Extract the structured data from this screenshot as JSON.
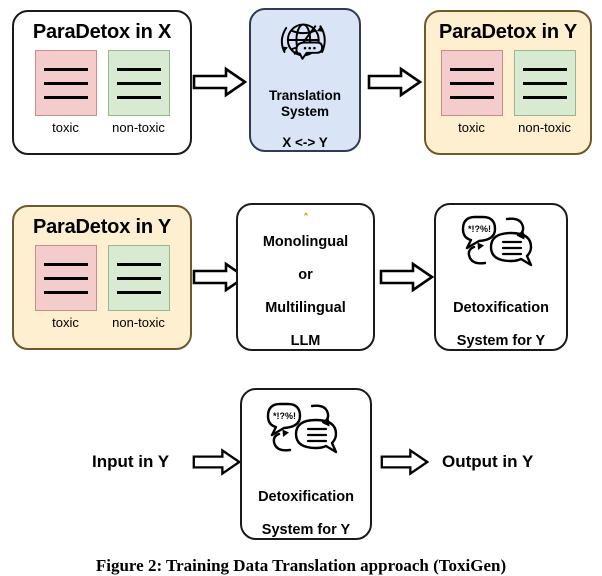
{
  "figure": {
    "caption": "Figure 2: Training Data Translation approach (ToxiGen)"
  },
  "rows": [
    {
      "id": "row-translation",
      "nodes": [
        {
          "type": "dataset",
          "name": "paradetox-in-x",
          "title": "ParaDetox in X",
          "columns": [
            {
              "label": "toxic",
              "color": "#f5cccc",
              "lines": 3
            },
            {
              "label": "non-toxic",
              "color": "#d9ead3",
              "lines": 3
            }
          ]
        },
        {
          "type": "arrow",
          "name": "arrow-x-to-translation"
        },
        {
          "type": "process",
          "name": "translation-system",
          "icon": "globe-translate-icon",
          "lines": [
            "Translation System",
            "X <-> Y"
          ],
          "fill": "#d9e4f7"
        },
        {
          "type": "arrow",
          "name": "arrow-translation-to-y"
        },
        {
          "type": "dataset",
          "name": "paradetox-in-y-top",
          "title": "ParaDetox in Y",
          "fill": "#fdefd0",
          "columns": [
            {
              "label": "toxic",
              "color": "#f5cccc",
              "lines": 3
            },
            {
              "label": "non-toxic",
              "color": "#d9ead3",
              "lines": 3
            }
          ]
        }
      ]
    },
    {
      "id": "row-training",
      "nodes": [
        {
          "type": "dataset",
          "name": "paradetox-in-y-training",
          "title": "ParaDetox in Y",
          "fill": "#fdefd0",
          "columns": [
            {
              "label": "toxic",
              "color": "#f5cccc",
              "lines": 3
            },
            {
              "label": "non-toxic",
              "color": "#d9ead3",
              "lines": 3
            }
          ]
        },
        {
          "type": "arrow",
          "name": "arrow-dataset-to-llm"
        },
        {
          "type": "process",
          "name": "llm-box",
          "icon": "hugging-face-icon",
          "lines": [
            "Monolingual",
            "or",
            "Multilingual",
            "LLM"
          ],
          "fill": "#ffffff"
        },
        {
          "type": "arrow",
          "name": "arrow-llm-to-detox"
        },
        {
          "type": "process",
          "name": "detoxification-system-trained",
          "icon": "speech-bubbles-detox-icon",
          "lines": [
            "Detoxification",
            "System for Y"
          ],
          "fill": "#ffffff"
        }
      ]
    },
    {
      "id": "row-inference",
      "nodes": [
        {
          "type": "label",
          "name": "input-label",
          "text": "Input in Y"
        },
        {
          "type": "arrow",
          "name": "arrow-input-to-detox"
        },
        {
          "type": "process",
          "name": "detoxification-system-inference",
          "icon": "speech-bubbles-detox-icon",
          "lines": [
            "Detoxification",
            "System for Y"
          ],
          "fill": "#ffffff"
        },
        {
          "type": "arrow",
          "name": "arrow-detox-to-output"
        },
        {
          "type": "label",
          "name": "output-label",
          "text": "Output in Y"
        }
      ]
    }
  ],
  "text": {
    "paradetox_x_title": "ParaDetox in X",
    "paradetox_y_title": "ParaDetox in Y",
    "toxic_label": "toxic",
    "nontoxic_label": "non-toxic",
    "translation_line1": "Translation System",
    "translation_line2": "X <-> Y",
    "llm_line1": "Monolingual",
    "llm_line2": "or",
    "llm_line3": "Multilingual",
    "llm_line4": "LLM",
    "detox_line1": "Detoxification",
    "detox_line2": "System for Y",
    "input_in_y": "Input in Y",
    "output_in_y": "Output in Y"
  },
  "colors": {
    "toxic_fill": "#f5cccc",
    "nontoxic_fill": "#d9ead3",
    "translation_fill": "#d9e4f7",
    "paradetox_y_fill": "#fdefd0",
    "stroke": "#1a1a1a",
    "background": "#ffffff"
  }
}
